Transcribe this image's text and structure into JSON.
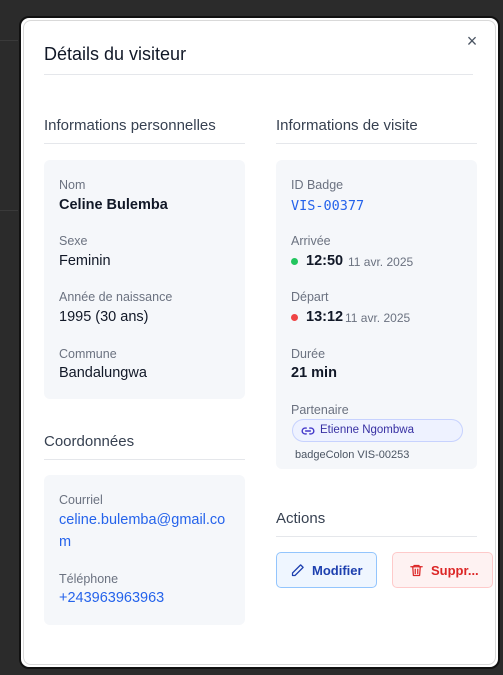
{
  "modal": {
    "title": "Détails du visiteur",
    "close_symbol": "×"
  },
  "personal": {
    "title": "Informations personnelles",
    "name_label": "Nom",
    "name": "Celine Bulemba",
    "sex_label": "Sexe",
    "sex": "Feminin",
    "birth_label": "Année de naissance",
    "birth": "1995 (30 ans)",
    "commune_label": "Commune",
    "commune": "Bandalungwa"
  },
  "contact": {
    "title": "Coordonnées",
    "email_label": "Courriel",
    "email_line1": "celine.bulemba@gmail.co",
    "email_line2": "m",
    "phone_label": "Téléphone",
    "phone": "+243963963963"
  },
  "visit": {
    "title": "Informations de visite",
    "badge_label": "ID Badge",
    "badge": "VIS-00377",
    "arrival_label": "Arrivée",
    "arrival_time": "12:50",
    "arrival_date": "11 avr. 2025",
    "departure_label": "Départ",
    "departure_time": "13:12",
    "departure_date": "11 avr. 2025",
    "duration_label": "Durée",
    "duration": "21 min",
    "partner_label": "Partenaire",
    "partner_name": "Etienne Ngombwa",
    "partner_badge_note": "badgeColon VIS-00253"
  },
  "actions": {
    "title": "Actions",
    "edit_label": "Modifier",
    "delete_label": "Suppr..."
  },
  "colors": {
    "arrival_dot": "#22c55e",
    "departure_dot": "#ef4444",
    "link": "#2563eb"
  },
  "icons": {
    "close": "close-icon",
    "link": "link-icon",
    "edit": "pencil-icon",
    "delete": "trash-icon"
  }
}
